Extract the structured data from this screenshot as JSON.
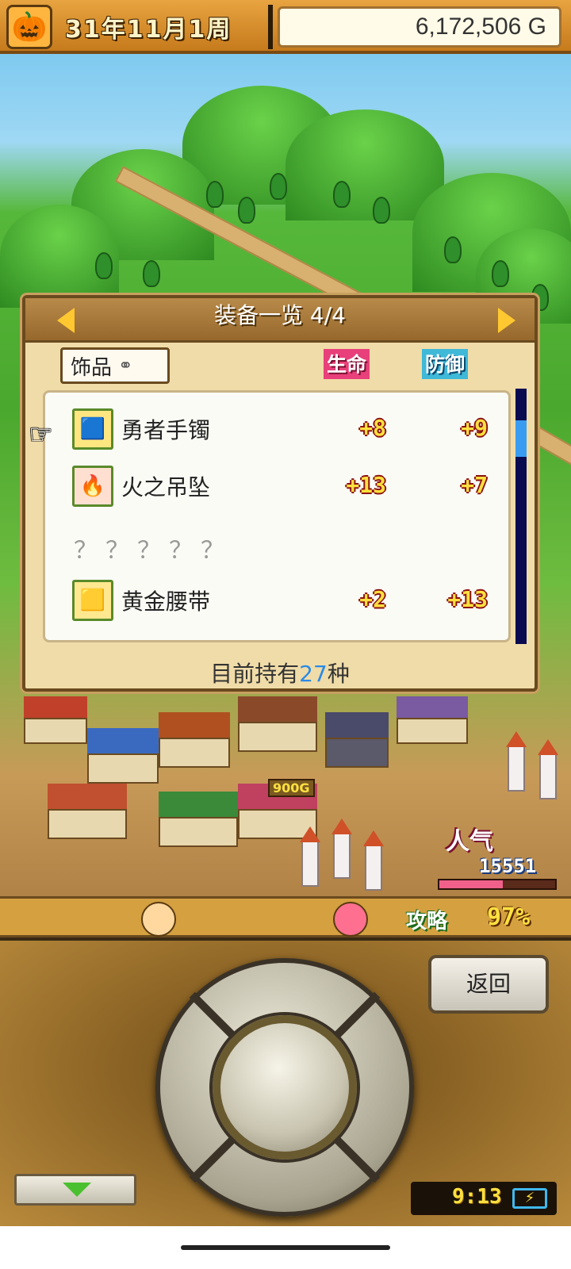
{
  "header": {
    "date": "31年11月1周",
    "money": "6,172,506 G"
  },
  "panel": {
    "title": "装备一览 4/4",
    "category_tab": "饰品",
    "columns": {
      "life": "生命",
      "defense": "防御"
    },
    "items": [
      {
        "name": "勇者手镯",
        "icon": "bracelet-icon",
        "life": "+8",
        "defense": "+9",
        "selected": true
      },
      {
        "name": "火之吊坠",
        "icon": "pendant-icon",
        "life": "+13",
        "defense": "+7"
      },
      {
        "name": "？？？？？",
        "unknown": true
      },
      {
        "name": "黄金腰带",
        "icon": "belt-icon",
        "life": "+2",
        "defense": "+13"
      }
    ],
    "owned_prefix": "目前持有",
    "owned_count": "27",
    "owned_suffix": "种"
  },
  "scene": {
    "price_tag": "900G",
    "popularity_label": "人气",
    "popularity_value": "15551",
    "strategy_label": "攻略",
    "strategy_value": "97%"
  },
  "controls": {
    "back_label": "返回",
    "clock": "9:13"
  },
  "colors": {
    "life_accent": "#e8407a",
    "defense_accent": "#40b8d8",
    "owned_count": "#2a8ae8",
    "stat_text": "#ffe040"
  }
}
